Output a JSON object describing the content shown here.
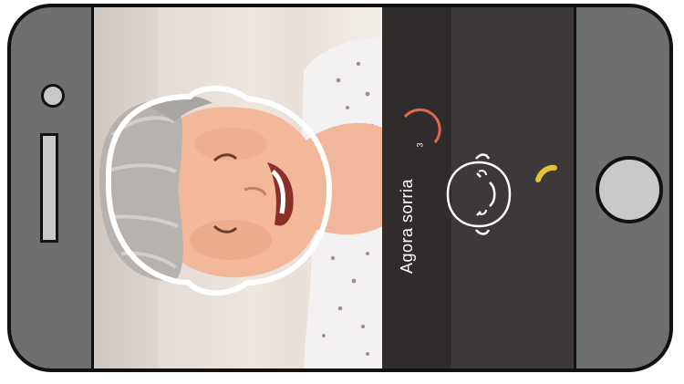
{
  "prompt": {
    "instruction": "Agora sorria",
    "countdown": "3"
  },
  "colors": {
    "countdown_ring": "#e0674a",
    "progress_arc": "#e5c33a",
    "face_outline": "#ffffff",
    "panel_dark": "#2f2c2b",
    "panel_mid": "#3c3938",
    "phone_body": "#6e6f71"
  },
  "icons": {
    "face_guide": "face-outline-icon",
    "smile_hint": "smiling-face-icon"
  }
}
